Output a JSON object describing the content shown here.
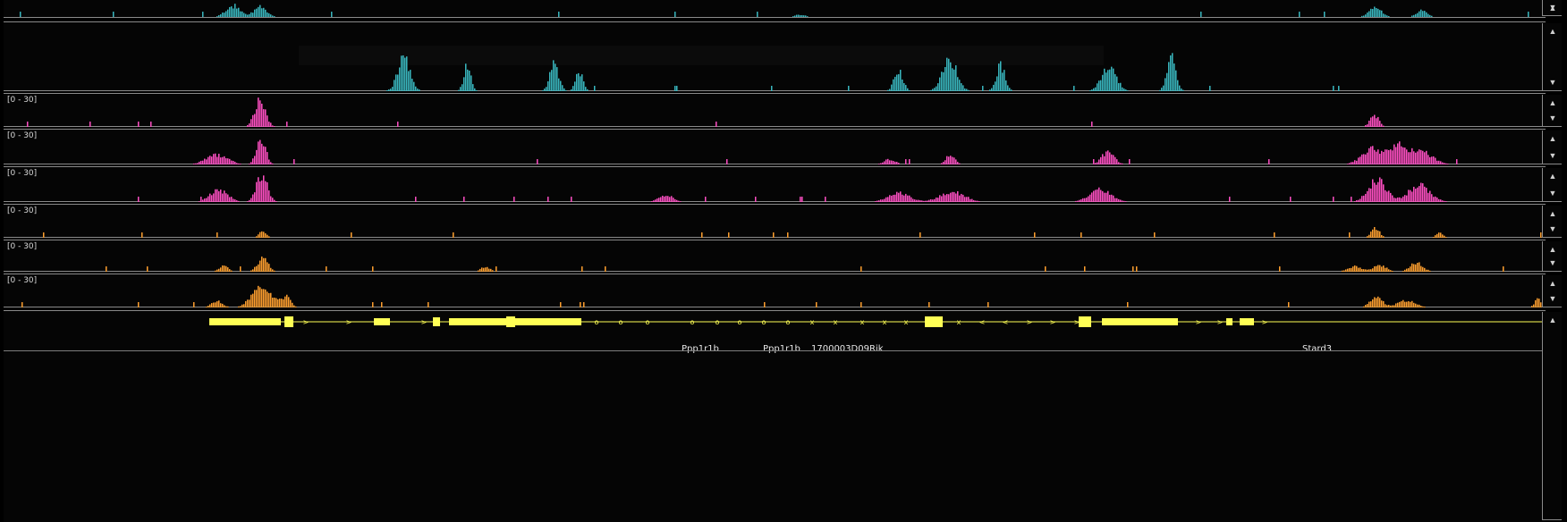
{
  "colors": {
    "teal": "#39b7bf",
    "magenta": "#ff4fc3",
    "orange": "#ff9f2e",
    "gene": "#ffff55",
    "background": "#050505",
    "border": "#8a8a8a"
  },
  "tracks": [
    {
      "id": "teal-1",
      "color": "teal",
      "range": "",
      "peaks": [
        [
          256,
          8,
          1.0
        ],
        [
          286,
          7,
          0.9
        ],
        [
          890,
          6,
          0.2
        ],
        [
          1533,
          7,
          0.85
        ],
        [
          1585,
          6,
          0.55
        ]
      ]
    },
    {
      "id": "teal-2",
      "color": "teal",
      "range": "",
      "peaks": [
        [
          447,
          7,
          0.55
        ],
        [
          518,
          4,
          0.45
        ],
        [
          615,
          5,
          0.45
        ],
        [
          643,
          4,
          0.35
        ],
        [
          1000,
          5,
          0.35
        ],
        [
          1057,
          8,
          0.55
        ],
        [
          1114,
          5,
          0.45
        ],
        [
          1235,
          8,
          0.45
        ],
        [
          1305,
          5,
          0.55
        ]
      ]
    },
    {
      "id": "magenta-1",
      "color": "magenta",
      "range": "[0 - 30]",
      "peaks": [
        [
          286,
          6,
          1.0
        ],
        [
          1532,
          5,
          0.45
        ]
      ]
    },
    {
      "id": "magenta-2",
      "color": "magenta",
      "range": "[0 - 30]",
      "peaks": [
        [
          238,
          12,
          0.35
        ],
        [
          287,
          5,
          1.0
        ],
        [
          990,
          6,
          0.2
        ],
        [
          1058,
          5,
          0.35
        ],
        [
          1234,
          7,
          0.45
        ],
        [
          1530,
          12,
          0.55
        ],
        [
          1560,
          10,
          0.62
        ],
        [
          1585,
          12,
          0.45
        ]
      ]
    },
    {
      "id": "magenta-3",
      "color": "magenta",
      "range": "[0 - 30]",
      "peaks": [
        [
          240,
          10,
          0.42
        ],
        [
          288,
          6,
          1.0
        ],
        [
          740,
          8,
          0.25
        ],
        [
          1000,
          12,
          0.32
        ],
        [
          1060,
          14,
          0.36
        ],
        [
          1225,
          12,
          0.45
        ],
        [
          1535,
          10,
          0.8
        ],
        [
          1582,
          12,
          0.6
        ]
      ]
    },
    {
      "id": "orange-1",
      "color": "orange",
      "range": "[0 - 30]",
      "peaks": [
        [
          289,
          4,
          0.25
        ],
        [
          1533,
          5,
          0.35
        ],
        [
          1605,
          4,
          0.18
        ]
      ]
    },
    {
      "id": "orange-2",
      "color": "orange",
      "range": "[0 - 30]",
      "peaks": [
        [
          245,
          5,
          0.25
        ],
        [
          289,
          6,
          0.55
        ],
        [
          538,
          5,
          0.2
        ],
        [
          1510,
          8,
          0.22
        ],
        [
          1538,
          7,
          0.28
        ],
        [
          1579,
          7,
          0.38
        ]
      ]
    },
    {
      "id": "orange-3",
      "color": "orange",
      "range": "[0 - 30]",
      "peaks": [
        [
          238,
          6,
          0.25
        ],
        [
          288,
          11,
          0.8
        ],
        [
          315,
          5,
          0.4
        ],
        [
          1534,
          7,
          0.38
        ],
        [
          1568,
          10,
          0.28
        ],
        [
          1715,
          4,
          0.32
        ]
      ]
    }
  ],
  "genes": {
    "labels": [
      {
        "text": "Ppp1r1b"
      },
      {
        "text": "Ppp1r1b"
      },
      {
        "text": "1700003D09Rik"
      },
      {
        "text": "Stard3"
      }
    ],
    "strand_marks": [
      ">",
      ">",
      ">",
      "<",
      "<",
      "<",
      "<",
      "o",
      "o",
      "o",
      "o",
      "o",
      "o",
      "o",
      "o",
      "x",
      "x",
      "x",
      "x",
      "x",
      "x",
      "<",
      "<",
      ">",
      ">",
      ">",
      ">",
      ">",
      ">"
    ]
  },
  "scroll": {
    "up": "▲",
    "down": "▼"
  }
}
